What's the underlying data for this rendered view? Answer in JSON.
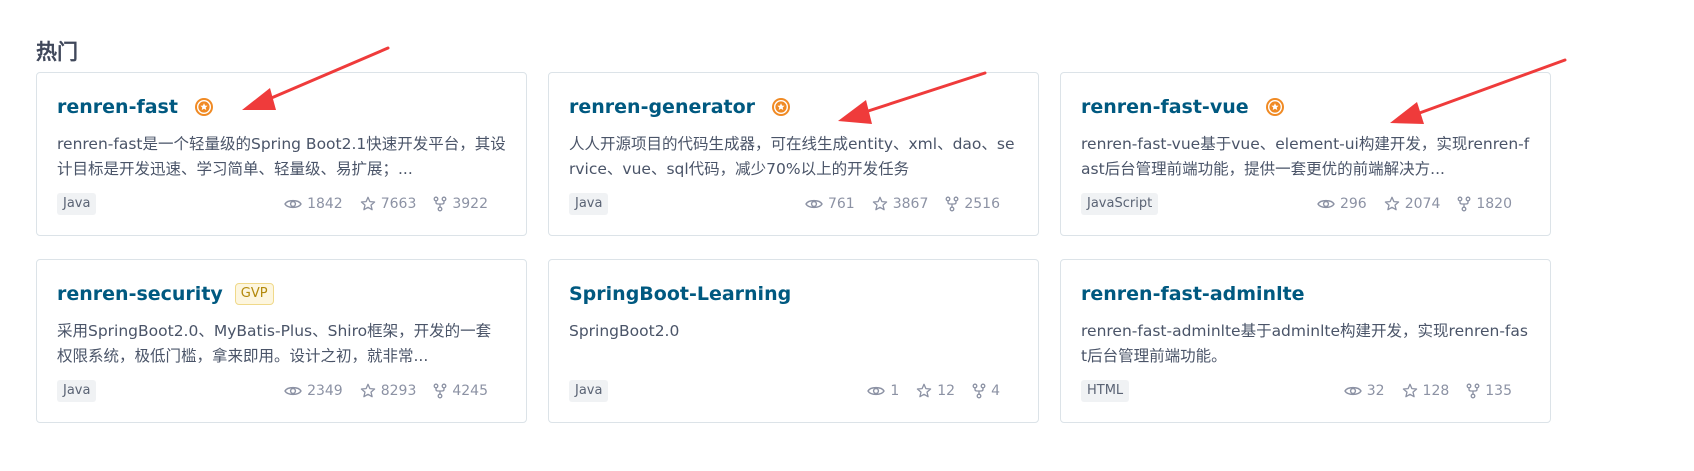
{
  "section": {
    "title": "热门"
  },
  "colors": {
    "name": "#005980",
    "medal": "#f08a24",
    "arrow": "#ef3b3b"
  },
  "cards": [
    {
      "name": "renren-fast",
      "description": "renren-fast是一个轻量级的Spring Boot2.1快速开发平台，其设计目标是开发迅速、学习简单、轻量级、易扩展；...",
      "language": "Java",
      "views": "1842",
      "stars": "7663",
      "forks": "3922",
      "recommended_icon": "medal-icon"
    },
    {
      "name": "renren-generator",
      "description": "人人开源项目的代码生成器，可在线生成entity、xml、dao、service、vue、sql代码，减少70%以上的开发任务",
      "language": "Java",
      "views": "761",
      "stars": "3867",
      "forks": "2516",
      "recommended_icon": "medal-icon"
    },
    {
      "name": "renren-fast-vue",
      "description": "renren-fast-vue基于vue、element-ui构建开发，实现renren-fast后台管理前端功能，提供一套更优的前端解决方...",
      "language": "JavaScript",
      "views": "296",
      "stars": "2074",
      "forks": "1820",
      "recommended_icon": "medal-icon"
    },
    {
      "name": "renren-security",
      "badge": "GVP",
      "description": "采用SpringBoot2.0、MyBatis-Plus、Shiro框架，开发的一套权限系统，极低门槛，拿来即用。设计之初，就非常...",
      "language": "Java",
      "views": "2349",
      "stars": "8293",
      "forks": "4245"
    },
    {
      "name": "SpringBoot-Learning",
      "description": "SpringBoot2.0",
      "language": "Java",
      "views": "1",
      "stars": "12",
      "forks": "4"
    },
    {
      "name": "renren-fast-adminlte",
      "description": "renren-fast-adminlte基于adminlte构建开发，实现renren-fast后台管理前端功能。",
      "language": "HTML",
      "views": "32",
      "stars": "128",
      "forks": "135"
    }
  ]
}
